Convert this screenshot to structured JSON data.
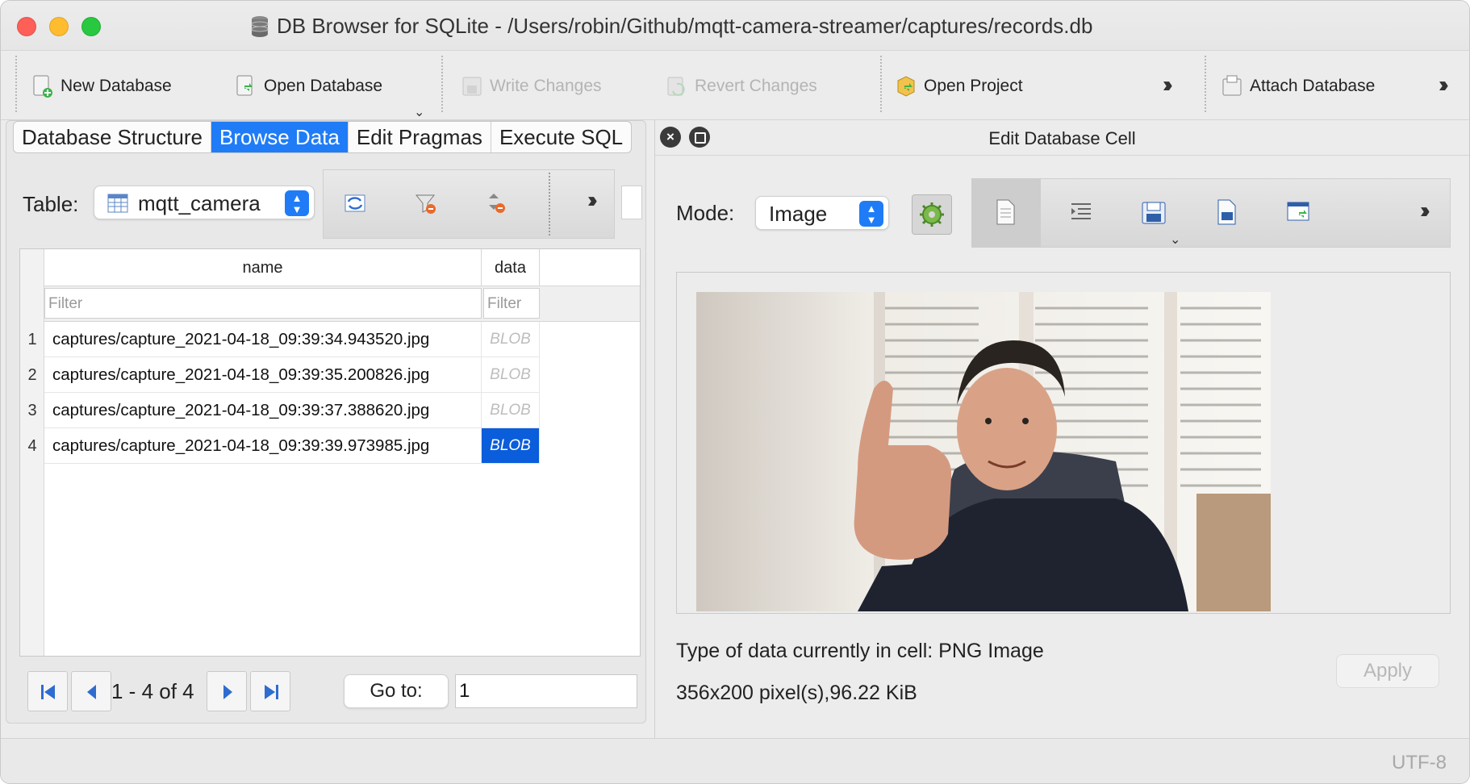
{
  "window": {
    "title": "DB Browser for SQLite - /Users/robin/Github/mqtt-camera-streamer/captures/records.db"
  },
  "toolbar": {
    "new_database": "New Database",
    "open_database": "Open Database",
    "write_changes": "Write Changes",
    "revert_changes": "Revert Changes",
    "open_project": "Open Project",
    "attach_database": "Attach Database"
  },
  "tabs": [
    "Database Structure",
    "Browse Data",
    "Edit Pragmas",
    "Execute SQL"
  ],
  "browse": {
    "table_label": "Table:",
    "table_value": "mqtt_camera",
    "columns": [
      "name",
      "data"
    ],
    "filter_placeholder": "Filter",
    "rows": [
      {
        "num": "1",
        "name": "captures/capture_2021-04-18_09:39:34.943520.jpg",
        "data": "BLOB"
      },
      {
        "num": "2",
        "name": "captures/capture_2021-04-18_09:39:35.200826.jpg",
        "data": "BLOB"
      },
      {
        "num": "3",
        "name": "captures/capture_2021-04-18_09:39:37.388620.jpg",
        "data": "BLOB"
      },
      {
        "num": "4",
        "name": "captures/capture_2021-04-18_09:39:39.973985.jpg",
        "data": "BLOB"
      }
    ],
    "range": "1 - 4 of 4",
    "goto_label": "Go to:",
    "goto_value": "1"
  },
  "edit_cell": {
    "title": "Edit Database Cell",
    "mode_label": "Mode:",
    "mode_value": "Image",
    "type_text": "Type of data currently in cell: PNG Image",
    "size_text": "356x200 pixel(s),96.22 KiB",
    "apply": "Apply"
  },
  "status": {
    "encoding": "UTF-8"
  },
  "colors": {
    "accent": "#1f7cf6",
    "selection": "#0a5ddb"
  }
}
